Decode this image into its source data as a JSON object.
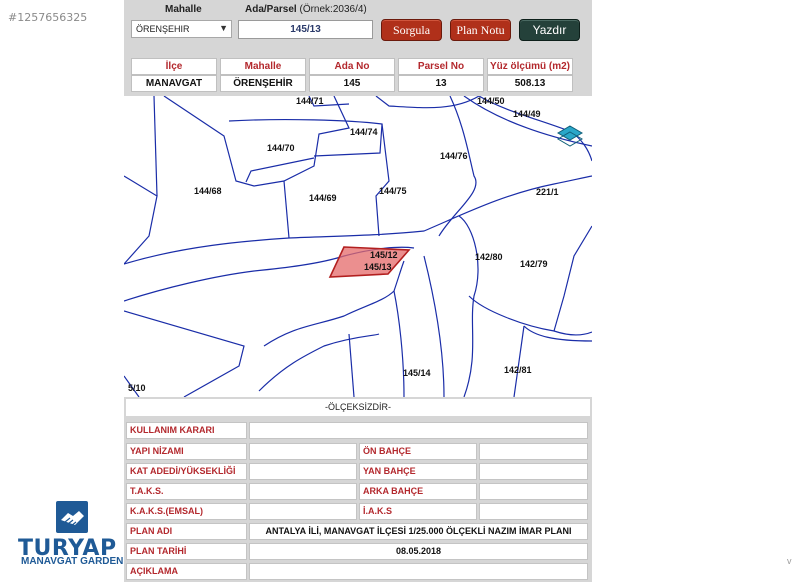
{
  "listing_id": "#1257656325",
  "search": {
    "mahalle_label": "Mahalle",
    "ada_label": "Ada/Parsel",
    "ada_hint": "(Örnek:2036/4)",
    "mahalle_value": "ÖRENŞEHIR",
    "parcel_value": "145/13",
    "sorgula_label": "Sorgula",
    "plan_notu_label": "Plan Notu",
    "yazdir_label": "Yazdır"
  },
  "info": {
    "headers": [
      "İlçe",
      "Mahalle",
      "Ada No",
      "Parsel No",
      "Yüz ölçümü (m2)"
    ],
    "values": [
      "MANAVGAT",
      "ÖRENŞEHİR",
      "145",
      "13",
      "508.13"
    ]
  },
  "map": {
    "parcels": [
      "144/71",
      "144/50",
      "144/49",
      "144/74",
      "144/70",
      "144/76",
      "144/68",
      "144/69",
      "144/75",
      "221/1",
      "145/12",
      "145/13",
      "142/80",
      "142/79",
      "145/14",
      "142/81"
    ],
    "scale": "5/10",
    "highlight_color": "#e46a6a"
  },
  "olcek_text": "-ÖLÇEKSİZDİR-",
  "zoning": {
    "kullanim_karari": "KULLANIM KARARI",
    "yapi_nizami": "YAPI NİZAMI",
    "on_bahce": "ÖN BAHÇE",
    "kat_adedi": "KAT ADEDİ/YÜKSEKLİĞİ",
    "yan_bahce": "YAN BAHÇE",
    "taks": "T.A.K.S.",
    "arka_bahce": "ARKA BAHÇE",
    "kaks": "K.A.K.S.(EMSAL)",
    "iaks": "İ.A.K.S",
    "plan_adi": "PLAN ADI",
    "plan_adi_value": "ANTALYA İLİ, MANAVGAT İLÇESİ 1/25.000 ÖLÇEKLİ NAZIM İMAR PLANI",
    "plan_tarihi": "PLAN TARİHİ",
    "plan_tarihi_value": "08.05.2018",
    "aciklama": "AÇIKLAMA"
  },
  "logo": {
    "brand": "TURYAP",
    "tagline": "MANAVGAT GARDEN",
    "color": "#1f5a96"
  },
  "corner_text": "v"
}
